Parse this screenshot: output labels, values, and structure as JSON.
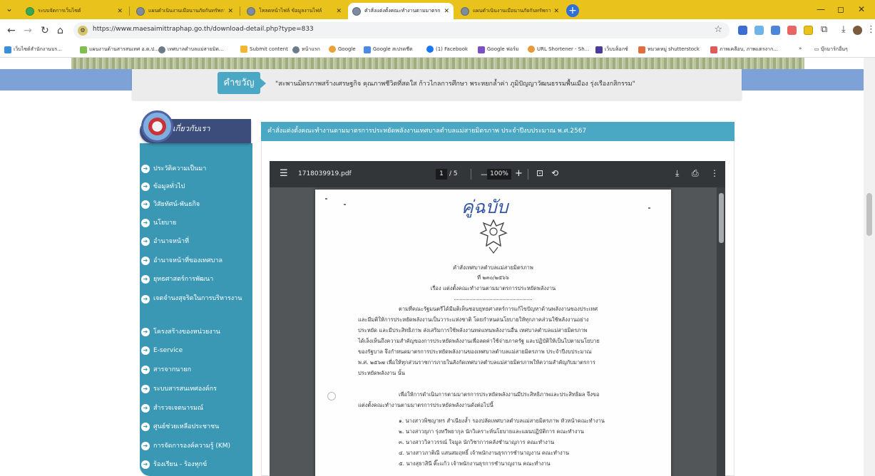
{
  "browser": {
    "tabs": [
      {
        "title": "ระบบจัดการเว็บไซต์",
        "active": false
      },
      {
        "title": "แผนดำเนินงานเมือนานภัยกันทรัพการ",
        "active": false
      },
      {
        "title": "โหลดหน้าไฟล์ ข้อมูลงานไฟล์",
        "active": false
      },
      {
        "title": "คำสั่งแต่งตั้งคณะทำงานตามมาตรการ",
        "active": true
      },
      {
        "title": "แผนดำเนินงานเมือนานภัยกันทรัพการ",
        "active": false
      }
    ],
    "new_tab": "+",
    "url": "https://www.maesaimittraphap.go.th/download-detail.php?type=833",
    "bookmarks": [
      "เว็บไซต์สำนักงานบร...",
      "แผนงานด้านสารสนเทศ อ.ต.ป...",
      "เทศบาลตำบลแม่สายมิต...",
      "Submit content",
      "หน้าแรก",
      "Google",
      "Google สเปรดชีต",
      "(1) Facebook",
      "Google ฟอร์ม",
      "URL Shortener - Sh...",
      "เว็บบล็อกซ์",
      "หมวดหมู่ shutterstock",
      "ภาพเคลือบ, ภาพแตรงาก..."
    ],
    "bookmarks_more": "»",
    "other_bookmarks": "บุ๊กมาร์กอื่นๆ",
    "colors": {
      "tabbar": "#e9c21b",
      "accent": "#2f6fd6"
    }
  },
  "site": {
    "motto_label": "คำขวัญ",
    "motto_text": "\"สะพานมิตรภาพสร้างเศรษฐกิจ คุณภาพชีวิตที่สดใส ก้าวไกลการศึกษา พระหยกล้ำค่า ภูมิปัญญาวัฒนธรรมพื้นเมือง รุ่งเรืองกสิกรรม\"",
    "sidebar_title": "เกี่ยวกับเรา",
    "sidebar_items": [
      "ประวัติความเป็นมา",
      "ข้อมูลทั่วไป",
      "วิสัยทัศน์-พันธกิจ",
      "นโยบาย",
      "อำนาจหน้าที่",
      "อำนาจหน้าที่ของเทศบาล",
      "ยุทธศาสตร์การพัฒนา",
      "เจตจำนงสุจริตในการบริหารงาน",
      "โครงสร้างของหน่วยงาน",
      "E-service",
      "สารจากนายก",
      "ระบบสารสนเทศองค์กร",
      "สำรวจเจตนารมณ์",
      "ศูนย์ช่วยเหลือประชาชน",
      "การจัดการองค์ความรู้ (KM)",
      "ร้องเรียน - ร้องทุกข์"
    ],
    "content_title": "คำสั่งแต่งตั้งคณะทำงานตามมาตรการประหยัดพลังงานเทศบาลตำบลแม่สายมิตรภาพ ประจำปีงบประมาณ พ.ศ.2567",
    "colors": {
      "teal": "#4aa8c4",
      "band": "#7ea2d8",
      "sidebar": "#3a98b5"
    }
  },
  "pdf": {
    "filename": "1718039919.pdf",
    "page": "1",
    "page_of": "/ 5",
    "zoom": "100%",
    "document": {
      "stamp": "คู่ฉบับ",
      "heading1": "คำสั่งเทศบาลตำบลแม่สายมิตรภาพ",
      "heading2": "ที่ ๒๓๐/๒๕๖๖",
      "subject": "เรื่อง  แต่งตั้งคณะทำงานตามมาตรการประหยัดพลังงาน",
      "para1": [
        "ตามที่คณะรัฐมนตรีได้มีมติเห็นชอบยุทธศาสตร์การแก้ไขปัญหาด้านพลังงานของประเทศ",
        "และมีมติให้การประหยัดพลังงานเป็นวาระแห่งชาติ โดยกำหนดนโยบายให้ทุกภาคส่วนใช้พลังงานอย่าง",
        "ประหยัด และมีประสิทธิภาพ ส่งเสริมการใช้พลังงานทดแทนพลังงานอื่น เทศบาลตำบลแม่สายมิตรภาพ",
        "ได้เล็งเห็นถึงความสำคัญของการประหยัดพลังงานเพื่อลดค่าใช้จ่ายภาครัฐ และปฏิบัติให้เป็นไปตามนโยบาย",
        "ของรัฐบาล จึงกำหนดมาตรการประหยัดพลังงานของเทศบาลตำบลแม่สายมิตรภาพ ประจำปีงบประมาณ",
        "พ.ศ. ๒๕๖๗ เพื่อให้ทุกส่วนราชการภายในสังกัดเทศบาลตำบลแม่สายมิตรภาพให้ความสำคัญกับมาตรการ",
        "ประหยัดพลังงาน นั้น"
      ],
      "para2": [
        "เพื่อให้การดำเนินการตามมาตรการประหยัดพลังงานมีประสิทธิภาพและประสิทธิผล จึงขอ",
        "แต่งตั้งคณะทำงานตามมาตรการประหยัดพลังงานดังต่อไปนี้"
      ],
      "members": [
        "๑. นางสาวพิชญาทร สำเนียงล้ำ รองปลัดเทศบาลตำบลแม่สายมิตรภาพ หัวหน้าคณะทำงาน",
        "๒. นางสาวยุภา รุ่งทวีพยากุล  นักวิเคราะห์นโยบายและแผนปฏิบัติการ      คณะทำงาน",
        "๓. นางสาววิลาวรรณ์ ใจมูล      นักวิชาการคลังชำนาญการ                  คณะทำงาน",
        "๔. นางสาวภาติณี แสนสมฤทธิ์   เจ้าพนักงานธุรการชำนาญงาน              คณะทำงาน",
        "๕. นางสุธาสินี ติ๊ะแก้ว          เจ้าพนักงานธุรการชำนาญงาน              คณะทำงาน"
      ]
    }
  }
}
